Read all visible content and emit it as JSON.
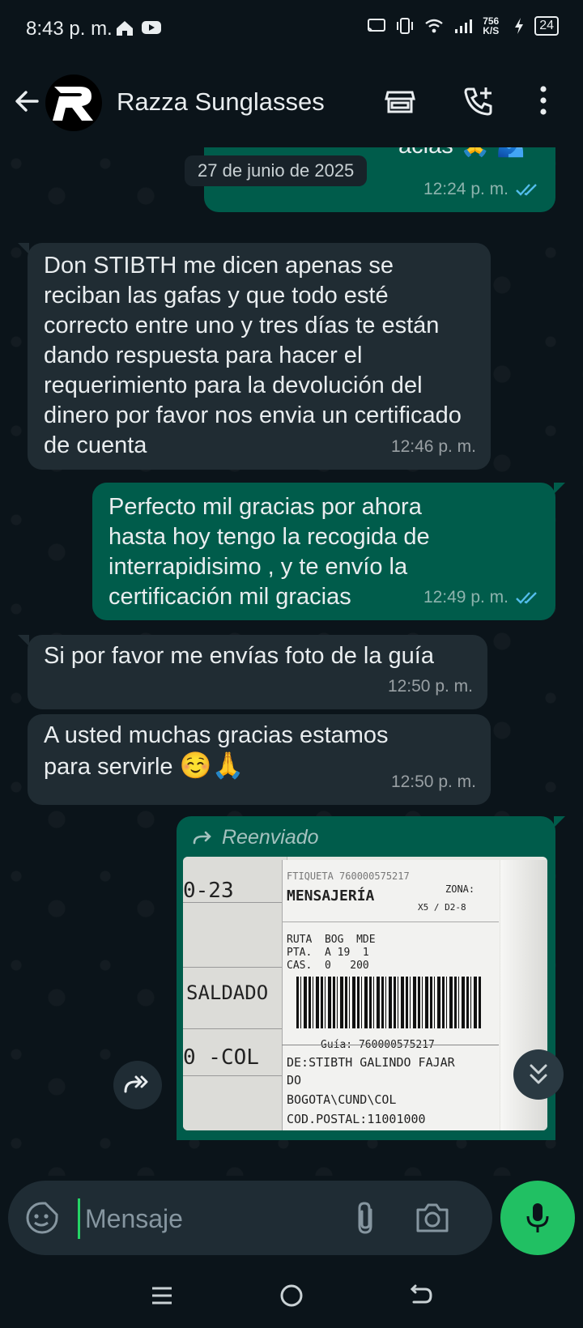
{
  "status_bar": {
    "time": "8:43 p. m.",
    "network_speed": "756 K/S",
    "battery": "24"
  },
  "header": {
    "title": "Razza Sunglasses"
  },
  "date_pill": "27 de junio de 2025",
  "messages": [
    {
      "direction": "outgoing",
      "text": "acias",
      "time": "12:24 p. m.",
      "status": "read"
    },
    {
      "direction": "incoming",
      "text": "Don STIBTH   me dicen apenas se reciban las gafas y que todo esté correcto entre uno y tres días te están dando respuesta para hacer el requerimiento para la devolución del dinero por favor nos envia un certificado de cuenta",
      "time": "12:46 p. m."
    },
    {
      "direction": "outgoing",
      "text": "Perfecto mil gracias por ahora hasta hoy tengo la recogida de interrapidisimo , y te envío la certificación mil gracias",
      "time": "12:49 p. m.",
      "status": "read"
    },
    {
      "direction": "incoming",
      "text": "Si por favor me envías foto de la guía",
      "time": "12:50 p. m."
    },
    {
      "direction": "incoming",
      "text": "A usted  muchas gracias estamos para servirle",
      "time": "12:50 p. m."
    }
  ],
  "forwarded": {
    "label": "Reenviado",
    "receipt": {
      "top_code": "FTIQUETA 760000575217",
      "title": "MENSAJERÍA",
      "zone_label": "ZONA:",
      "zone_value": "X5 / D2-8",
      "route_line1": "RUTA  BOG  MDE",
      "route_line2": "PTA.  A 19  1",
      "route_line3": "CAS.  0   200",
      "guide": "Guía: 760000575217",
      "to": "DE:STIBTH GALINDO FAJAR",
      "to2": "DO",
      "city": "BOGOTA\\CUND\\COL",
      "postal": "COD.POSTAL:11001000",
      "left_1": "0-23",
      "left_2": "SALDADO",
      "left_3": "0 -COL"
    }
  },
  "composer": {
    "placeholder": "Mensaje"
  },
  "colors": {
    "background": "#0b141a",
    "incoming_bubble": "#202c33",
    "outgoing_bubble": "#005c4b",
    "read_ticks": "#53bdeb",
    "mic_button": "#21c063"
  }
}
